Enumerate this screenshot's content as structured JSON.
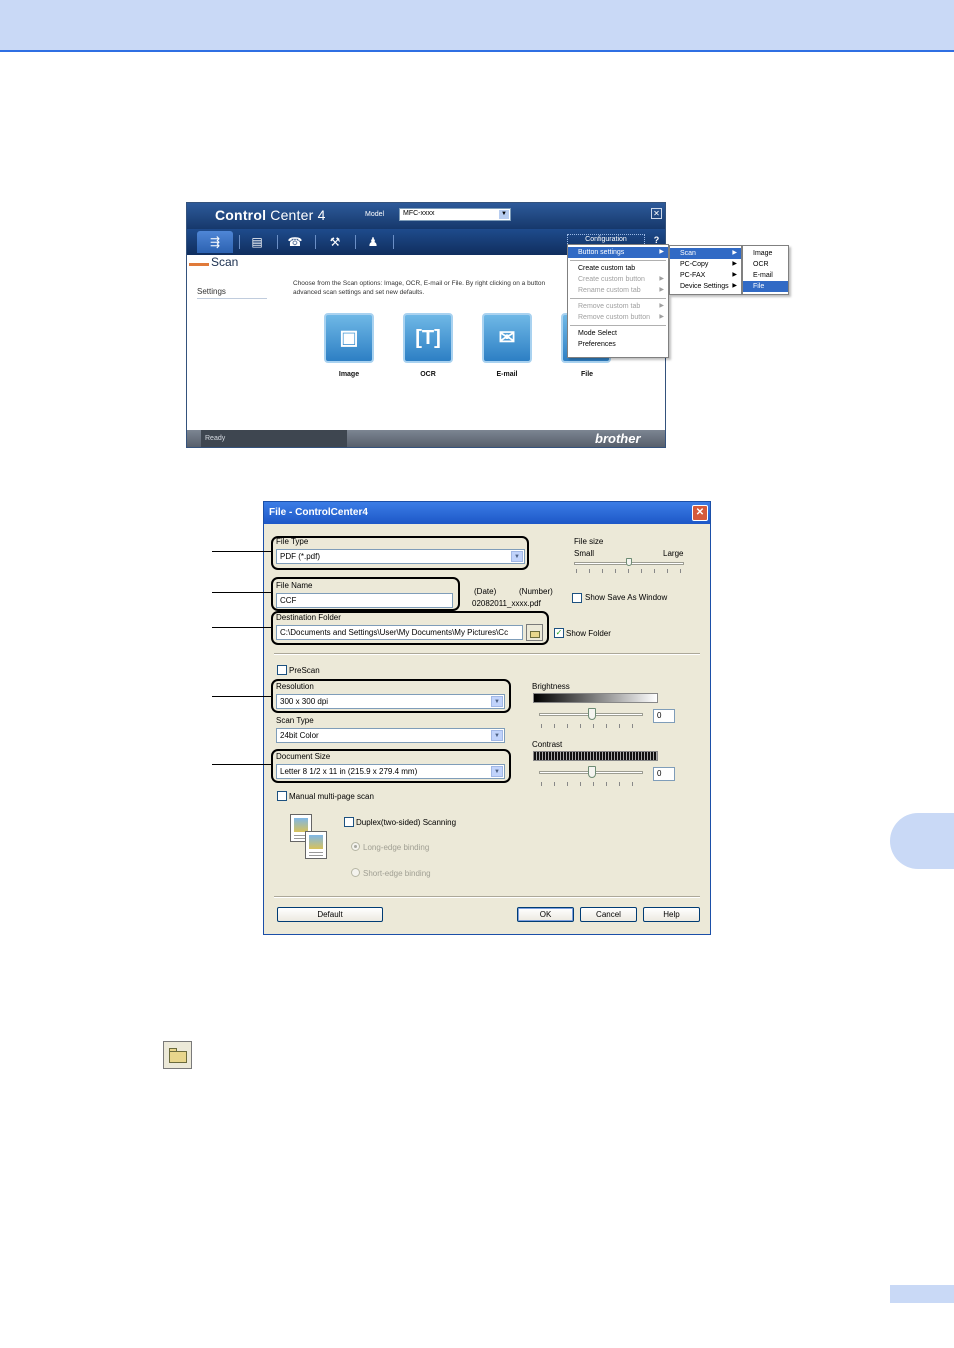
{
  "cc_window": {
    "brand_bold": "Control",
    "brand_light": "Center 4",
    "model_label": "Model",
    "model_value": "MFC-xxxx",
    "configuration_label": "Configuration",
    "help_label": "?",
    "close_label": "✕",
    "tabs": [
      {
        "name": "scan",
        "glyph": "⇶"
      },
      {
        "name": "pc-copy",
        "glyph": "▤"
      },
      {
        "name": "pc-fax",
        "glyph": "☎"
      },
      {
        "name": "device-settings",
        "glyph": "⚒"
      },
      {
        "name": "support",
        "glyph": "♟"
      }
    ],
    "section_title": "Scan",
    "sidebar_settings": "Settings",
    "description": "Choose from the Scan options: Image, OCR, E-mail or File. By right clicking on a button advanced scan settings and set new defaults.",
    "scan_buttons": [
      {
        "label": "Image",
        "glyph": "▣"
      },
      {
        "label": "OCR",
        "glyph": "[T]"
      },
      {
        "label": "E-mail",
        "glyph": "✉"
      },
      {
        "label": "File",
        "glyph": "▤"
      }
    ],
    "status": "Ready",
    "logo": "brother"
  },
  "config_menu": {
    "items": [
      {
        "label": "Button settings",
        "state": "selected",
        "submenu": true
      },
      {
        "label": "Create custom tab",
        "state": "normal",
        "submenu": false
      },
      {
        "label": "Create custom button",
        "state": "disabled",
        "submenu": true
      },
      {
        "label": "Rename custom tab",
        "state": "disabled",
        "submenu": true
      },
      {
        "label": "Remove custom tab",
        "state": "disabled",
        "submenu": true
      },
      {
        "label": "Remove custom button",
        "state": "disabled",
        "submenu": true
      },
      {
        "label": "Mode Select",
        "state": "normal",
        "submenu": false
      },
      {
        "label": "Preferences",
        "state": "normal",
        "submenu": false
      }
    ],
    "button_settings_submenu": [
      {
        "label": "Scan",
        "state": "selected"
      },
      {
        "label": "PC-Copy",
        "state": "normal"
      },
      {
        "label": "PC-FAX",
        "state": "normal"
      },
      {
        "label": "Device Settings",
        "state": "normal"
      }
    ],
    "scan_submenu": [
      {
        "label": "Image",
        "state": "normal"
      },
      {
        "label": "OCR",
        "state": "normal"
      },
      {
        "label": "E-mail",
        "state": "normal"
      },
      {
        "label": "File",
        "state": "selected"
      }
    ]
  },
  "file_dialog": {
    "title": "File - ControlCenter4",
    "close_label": "✕",
    "file_type_label": "File Type",
    "file_type_value": "PDF (*.pdf)",
    "file_size_label": "File size",
    "file_size_small": "Small",
    "file_size_large": "Large",
    "file_size_level": 0.5,
    "file_name_label": "File Name",
    "file_name_value": "CCF",
    "date_label": "(Date)",
    "number_label": "(Number)",
    "name_preview": "02082011_xxxx.pdf",
    "show_save_as_label": "Show Save As Window",
    "show_save_as_checked": false,
    "destination_label": "Destination Folder",
    "destination_value": "C:\\Documents and Settings\\User\\My Documents\\My Pictures\\Cc",
    "show_folder_label": "Show Folder",
    "show_folder_checked": true,
    "prescan_label": "PreScan",
    "resolution_label": "Resolution",
    "resolution_value": "300 x 300 dpi",
    "scan_type_label": "Scan Type",
    "scan_type_value": "24bit Color",
    "document_size_label": "Document Size",
    "document_size_value": "Letter 8 1/2 x 11 in (215.9 x 279.4 mm)",
    "brightness_label": "Brightness",
    "brightness_value": "0",
    "contrast_label": "Contrast",
    "contrast_value": "0",
    "manual_multipage_label": "Manual multi-page scan",
    "duplex_label": "Duplex(two-sided) Scanning",
    "long_edge_label": "Long-edge binding",
    "short_edge_label": "Short-edge binding",
    "default_button": "Default",
    "ok_button": "OK",
    "cancel_button": "Cancel",
    "help_button": "Help"
  },
  "colors": {
    "page_band": "#c9d9f6",
    "accent": "#2f6fe3",
    "menu_selected": "#316ac5"
  }
}
